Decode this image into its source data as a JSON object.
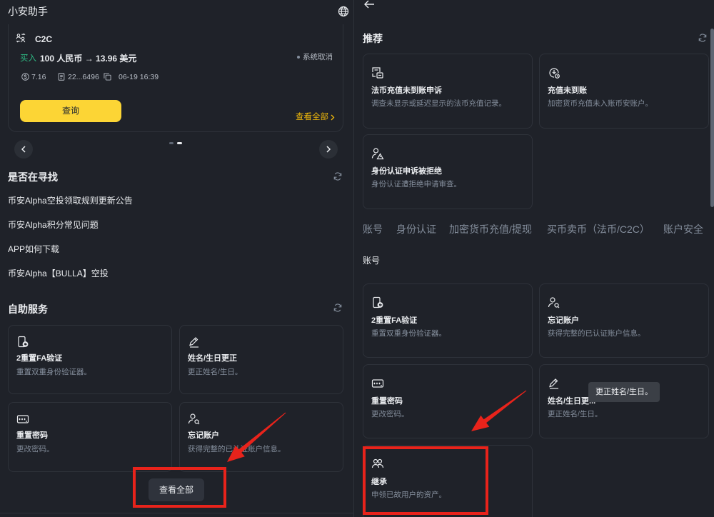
{
  "colors": {
    "background": "#1f2229",
    "card_border": "#2e323a",
    "text_primary": "#eaecef",
    "text_soft": "#b7bdc6",
    "text_secondary": "#848e9c",
    "buy_green": "#2ebd85",
    "brand_yellow": "#fcd535",
    "link_yellow": "#f0b90b",
    "annotation_red": "#e8231b"
  },
  "left": {
    "title": "小安助手",
    "order_card": {
      "product": "C2C",
      "side": "买入",
      "summary": "100 人民币 → 13.96 美元",
      "status": "系统取消",
      "price": "7.16",
      "order_id": "22...6496",
      "time": "06-19 16:39",
      "query_button": "查询",
      "view_all": "查看全部"
    },
    "carousel": {
      "pages": 2,
      "active_page": 2
    },
    "looking_for": {
      "title": "是否在寻找",
      "items": [
        "币安Alpha空投领取规则更新公告",
        "币安Alpha积分常见问题",
        "APP如何下载",
        "币安Alpha【BULLA】空投"
      ]
    },
    "self_service": {
      "title": "自助服务",
      "cards": [
        {
          "icon": "phone-reset-icon",
          "title": "2重置FA验证",
          "desc": "重置双重身份验证器。"
        },
        {
          "icon": "pencil-icon",
          "title": "姓名/生日更正",
          "desc": "更正姓名/生日。"
        },
        {
          "icon": "password-icon",
          "title": "重置密码",
          "desc": "更改密码。"
        },
        {
          "icon": "user-search-icon",
          "title": "忘记账户",
          "desc": "获得完整的已认证账户信息。"
        }
      ],
      "view_all_button": "查看全部"
    }
  },
  "right": {
    "recommended": {
      "title": "推荐",
      "cards": [
        {
          "icon": "fiat-deposit-icon",
          "title": "法币充值未到账申诉",
          "desc": "调查未显示或延迟显示的法币充值记录。"
        },
        {
          "icon": "deposit-clock-icon",
          "title": "充值未到账",
          "desc": "加密货币充值未入账币安账户。"
        },
        {
          "icon": "id-warning-icon",
          "title": "身份认证申诉被拒绝",
          "desc": "身份认证遭拒绝申请审查。"
        }
      ]
    },
    "tabs": [
      "账号",
      "身份认证",
      "加密货币充值/提现",
      "买币卖币（法币/C2C）",
      "账户安全"
    ],
    "section_title": "账号",
    "cards": [
      {
        "icon": "phone-reset-icon",
        "title": "2重置FA验证",
        "desc": "重置双重身份验证器。"
      },
      {
        "icon": "user-search-icon",
        "title": "忘记账户",
        "desc": "获得完整的已认证账户信息。"
      },
      {
        "icon": "password-icon",
        "title": "重置密码",
        "desc": "更改密码。"
      },
      {
        "icon": "pencil-icon",
        "title": "姓名/生日更...",
        "desc": "更正姓名/生日。"
      },
      {
        "icon": "people-icon",
        "title": "继承",
        "desc": "申领已故用户的资产。"
      }
    ],
    "tooltip": "更正姓名/生日。"
  }
}
